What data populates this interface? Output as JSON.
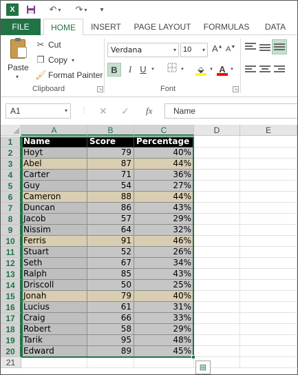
{
  "app": {
    "logo_letter": "X",
    "accent": "#217346"
  },
  "qat": {
    "icons": [
      "excel-logo-icon",
      "save-icon",
      "undo-icon",
      "redo-icon",
      "customize-qat-icon"
    ]
  },
  "tabs": [
    {
      "label": "FILE"
    },
    {
      "label": "HOME"
    },
    {
      "label": "INSERT"
    },
    {
      "label": "PAGE LAYOUT"
    },
    {
      "label": "FORMULAS"
    },
    {
      "label": "DATA"
    }
  ],
  "clipboard": {
    "paste_label": "Paste",
    "cut_label": "Cut",
    "copy_label": "Copy",
    "format_painter_label": "Format Painter",
    "group_label": "Clipboard"
  },
  "font": {
    "family": "Verdana",
    "size": "10",
    "group_label": "Font",
    "bold": "B",
    "italic": "I",
    "underline": "U",
    "grow": "A",
    "shrink": "A",
    "font_color_letter": "A",
    "fill_color": "#ffff00",
    "font_color": "#ff0000"
  },
  "formula_bar": {
    "cell_ref": "A1",
    "fx": "fx",
    "content": "Name"
  },
  "sheet": {
    "columns": [
      "A",
      "B",
      "C",
      "D",
      "E"
    ],
    "header": [
      "Name",
      "Score",
      "Percentage"
    ],
    "rows": [
      {
        "name": "Hoyt",
        "score": "79",
        "pct": "40%",
        "highlight": false
      },
      {
        "name": "Abel",
        "score": "87",
        "pct": "44%",
        "highlight": true
      },
      {
        "name": "Carter",
        "score": "71",
        "pct": "36%",
        "highlight": false
      },
      {
        "name": "Guy",
        "score": "54",
        "pct": "27%",
        "highlight": false
      },
      {
        "name": "Cameron",
        "score": "88",
        "pct": "44%",
        "highlight": true
      },
      {
        "name": "Duncan",
        "score": "86",
        "pct": "43%",
        "highlight": false
      },
      {
        "name": "Jacob",
        "score": "57",
        "pct": "29%",
        "highlight": false
      },
      {
        "name": "Nissim",
        "score": "64",
        "pct": "32%",
        "highlight": false
      },
      {
        "name": "Ferris",
        "score": "91",
        "pct": "46%",
        "highlight": true
      },
      {
        "name": "Stuart",
        "score": "52",
        "pct": "26%",
        "highlight": false
      },
      {
        "name": "Seth",
        "score": "67",
        "pct": "34%",
        "highlight": false
      },
      {
        "name": "Ralph",
        "score": "85",
        "pct": "43%",
        "highlight": false
      },
      {
        "name": "Driscoll",
        "score": "50",
        "pct": "25%",
        "highlight": false
      },
      {
        "name": "Jonah",
        "score": "79",
        "pct": "40%",
        "highlight": true
      },
      {
        "name": "Lucius",
        "score": "61",
        "pct": "31%",
        "highlight": false
      },
      {
        "name": "Craig",
        "score": "66",
        "pct": "33%",
        "highlight": false
      },
      {
        "name": "Robert",
        "score": "58",
        "pct": "29%",
        "highlight": false
      },
      {
        "name": "Tarik",
        "score": "95",
        "pct": "48%",
        "highlight": false
      },
      {
        "name": "Edward",
        "score": "89",
        "pct": "45%",
        "highlight": false
      }
    ],
    "colors": {
      "header_bg": "#000000",
      "header_fg": "#ffffff",
      "highlight_bg": "#d9ceb2",
      "name_bg": "#bfbfbf",
      "data_bg": "#c6c6c6"
    }
  }
}
